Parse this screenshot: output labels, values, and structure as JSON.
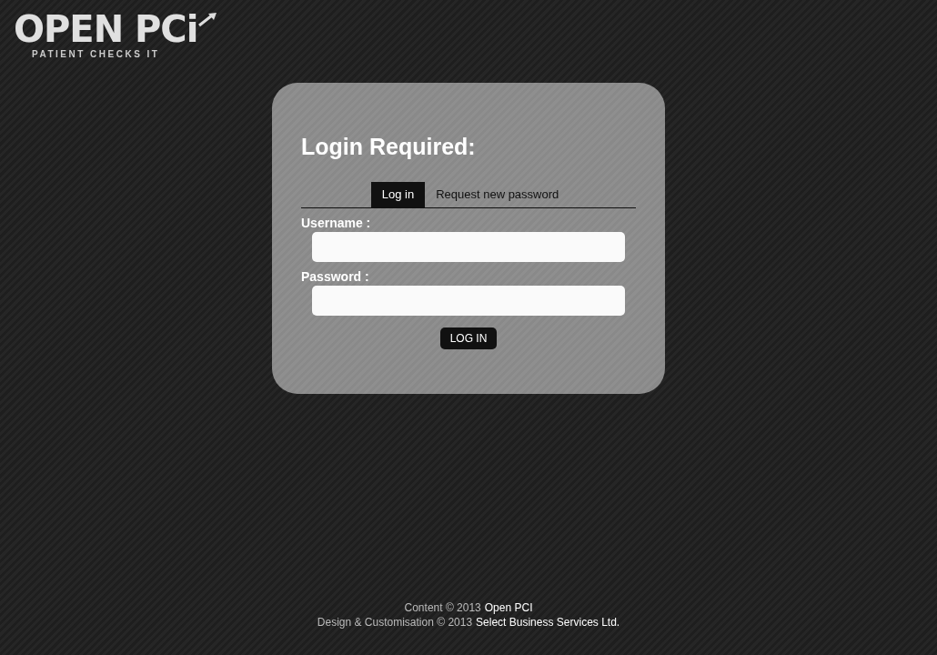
{
  "logo": {
    "title": "OPEN PCi",
    "tagline": "PATIENT CHECKS IT"
  },
  "login": {
    "heading": "Login Required:",
    "tabs": [
      {
        "label": "Log in",
        "selected": true
      },
      {
        "label": "Request new password",
        "selected": false
      }
    ],
    "fields": [
      {
        "label": "Username :"
      },
      {
        "label": "Password :"
      }
    ],
    "submit": "LOG IN"
  },
  "footer": [
    {
      "text": "Content © 2013",
      "link": "Open PCI"
    },
    {
      "text": "Design & Customisation © 2013",
      "link": "Select Business Services Ltd."
    }
  ]
}
